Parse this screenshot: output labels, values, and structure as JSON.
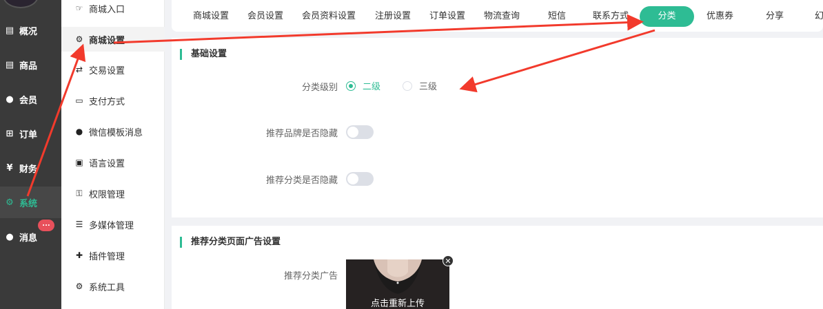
{
  "nav": {
    "items": [
      {
        "label": "概况",
        "icon": "dashboard-icon"
      },
      {
        "label": "商品",
        "icon": "goods-icon"
      },
      {
        "label": "会员",
        "icon": "users-icon"
      },
      {
        "label": "订单",
        "icon": "cart-icon"
      },
      {
        "label": "财务",
        "icon": "yen-icon"
      },
      {
        "label": "系统",
        "icon": "gears-icon"
      },
      {
        "label": "消息",
        "icon": "chat-icon"
      }
    ],
    "msg_badge": "...",
    "active": "系统"
  },
  "submenu": {
    "items": [
      {
        "label": "商城入口",
        "icon": "hand-point-icon"
      },
      {
        "label": "商城设置",
        "icon": "gear-icon"
      },
      {
        "label": "交易设置",
        "icon": "exchange-icon"
      },
      {
        "label": "支付方式",
        "icon": "credit-card-icon"
      },
      {
        "label": "微信模板消息",
        "icon": "wechat-icon"
      },
      {
        "label": "语言设置",
        "icon": "language-icon"
      },
      {
        "label": "权限管理",
        "icon": "key-icon"
      },
      {
        "label": "多媒体管理",
        "icon": "list-icon"
      },
      {
        "label": "插件管理",
        "icon": "puzzle-icon"
      },
      {
        "label": "系统工具",
        "icon": "wrench-gear-icon"
      }
    ],
    "active": "商城设置"
  },
  "tabs": [
    {
      "label": "商城设置"
    },
    {
      "label": "会员设置"
    },
    {
      "label": "会员资料设置"
    },
    {
      "label": "注册设置"
    },
    {
      "label": "订单设置"
    },
    {
      "label": "物流查询"
    },
    {
      "label": "短信"
    },
    {
      "label": "联系方式"
    },
    {
      "label": "分类"
    },
    {
      "label": "优惠券"
    },
    {
      "label": "分享"
    },
    {
      "label": "幻"
    }
  ],
  "active_tab": "分类",
  "basic": {
    "title": "基础设置",
    "level_label": "分类级别",
    "level_options": [
      "二级",
      "三级"
    ],
    "level_selected": "二级",
    "hide_brand_label": "推荐品牌是否隐藏",
    "hide_brand_on": false,
    "hide_category_label": "推荐分类是否隐藏",
    "hide_category_on": false
  },
  "ad": {
    "title": "推荐分类页面广告设置",
    "label": "推荐分类广告",
    "reupload": "点击重新上传"
  },
  "colors": {
    "accent": "#2ebc94",
    "arrow": "#f23a2c"
  }
}
